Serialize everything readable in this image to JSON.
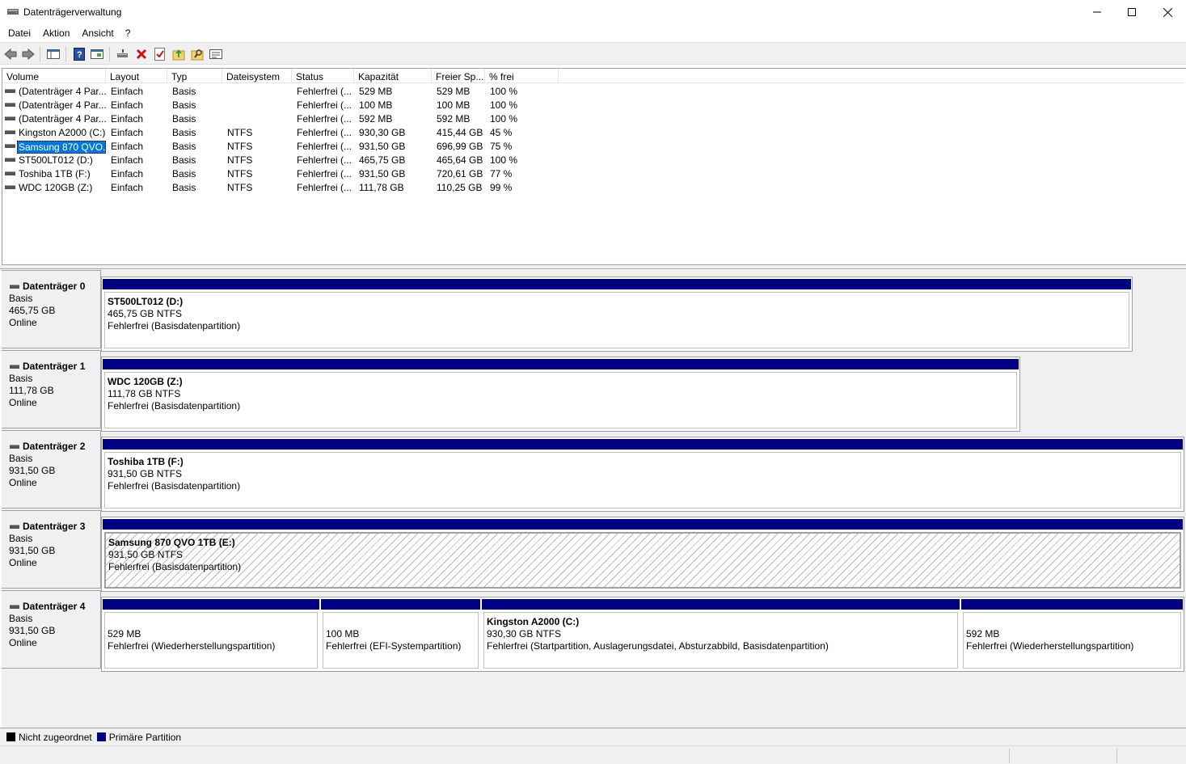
{
  "window": {
    "title": "Datenträgerverwaltung"
  },
  "menu": [
    "Datei",
    "Aktion",
    "Ansicht",
    "?"
  ],
  "columns": [
    "Volume",
    "Layout",
    "Typ",
    "Dateisystem",
    "Status",
    "Kapazität",
    "Freier Sp...",
    "% frei"
  ],
  "volumes": [
    {
      "volume": "(Datenträger 4 Par...",
      "layout": "Einfach",
      "typ": "Basis",
      "fs": "",
      "status": "Fehlerfrei (...",
      "kap": "529 MB",
      "frei": "529 MB",
      "pct": "100 %"
    },
    {
      "volume": "(Datenträger 4 Par...",
      "layout": "Einfach",
      "typ": "Basis",
      "fs": "",
      "status": "Fehlerfrei (...",
      "kap": "100 MB",
      "frei": "100 MB",
      "pct": "100 %"
    },
    {
      "volume": "(Datenträger 4 Par...",
      "layout": "Einfach",
      "typ": "Basis",
      "fs": "",
      "status": "Fehlerfrei (...",
      "kap": "592 MB",
      "frei": "592 MB",
      "pct": "100 %"
    },
    {
      "volume": "Kingston A2000 (C:)",
      "layout": "Einfach",
      "typ": "Basis",
      "fs": "NTFS",
      "status": "Fehlerfrei (...",
      "kap": "930,30 GB",
      "frei": "415,44 GB",
      "pct": "45 %"
    },
    {
      "volume": "Samsung 870 QVO...",
      "layout": "Einfach",
      "typ": "Basis",
      "fs": "NTFS",
      "status": "Fehlerfrei (...",
      "kap": "931,50 GB",
      "frei": "696,99 GB",
      "pct": "75 %"
    },
    {
      "volume": "ST500LT012 (D:)",
      "layout": "Einfach",
      "typ": "Basis",
      "fs": "NTFS",
      "status": "Fehlerfrei (...",
      "kap": "465,75 GB",
      "frei": "465,64 GB",
      "pct": "100 %"
    },
    {
      "volume": "Toshiba 1TB (F:)",
      "layout": "Einfach",
      "typ": "Basis",
      "fs": "NTFS",
      "status": "Fehlerfrei (...",
      "kap": "931,50 GB",
      "frei": "720,61 GB",
      "pct": "77 %"
    },
    {
      "volume": "WDC 120GB (Z:)",
      "layout": "Einfach",
      "typ": "Basis",
      "fs": "NTFS",
      "status": "Fehlerfrei (...",
      "kap": "111,78 GB",
      "frei": "110,25 GB",
      "pct": "99 %"
    }
  ],
  "disks": [
    {
      "name": "Datenträger 0",
      "type": "Basis",
      "size": "465,75 GB",
      "state": "Online",
      "partitions": [
        {
          "title": "ST500LT012  (D:)",
          "size": "465,75 GB NTFS",
          "status": "Fehlerfrei (Basisdatenpartition)"
        }
      ]
    },
    {
      "name": "Datenträger 1",
      "type": "Basis",
      "size": "111,78 GB",
      "state": "Online",
      "partitions": [
        {
          "title": "WDC 120GB  (Z:)",
          "size": "111,78 GB NTFS",
          "status": "Fehlerfrei (Basisdatenpartition)"
        }
      ]
    },
    {
      "name": "Datenträger 2",
      "type": "Basis",
      "size": "931,50 GB",
      "state": "Online",
      "partitions": [
        {
          "title": "Toshiba 1TB  (F:)",
          "size": "931,50 GB NTFS",
          "status": "Fehlerfrei (Basisdatenpartition)"
        }
      ]
    },
    {
      "name": "Datenträger 3",
      "type": "Basis",
      "size": "931,50 GB",
      "state": "Online",
      "partitions": [
        {
          "title": "Samsung 870 QVO 1TB  (E:)",
          "size": "931,50 GB NTFS",
          "status": "Fehlerfrei (Basisdatenpartition)"
        }
      ]
    },
    {
      "name": "Datenträger 4",
      "type": "Basis",
      "size": "931,50 GB",
      "state": "Online",
      "partitions": [
        {
          "title": "",
          "size": "529 MB",
          "status": "Fehlerfrei (Wiederherstellungspartition)"
        },
        {
          "title": "",
          "size": "100 MB",
          "status": "Fehlerfrei (EFI-Systempartition)"
        },
        {
          "title": "Kingston A2000  (C:)",
          "size": "930,30 GB NTFS",
          "status": "Fehlerfrei (Startpartition, Auslagerungsdatei, Absturzabbild, Basisdatenpartition)"
        },
        {
          "title": "",
          "size": "592 MB",
          "status": "Fehlerfrei (Wiederherstellungspartition)"
        }
      ]
    }
  ],
  "legend": {
    "unallocated": "Nicht zugeordnet",
    "primary": "Primäre Partition"
  },
  "colors": {
    "primary": "#000080",
    "unallocated": "#000000",
    "selection": "#0078d7"
  }
}
